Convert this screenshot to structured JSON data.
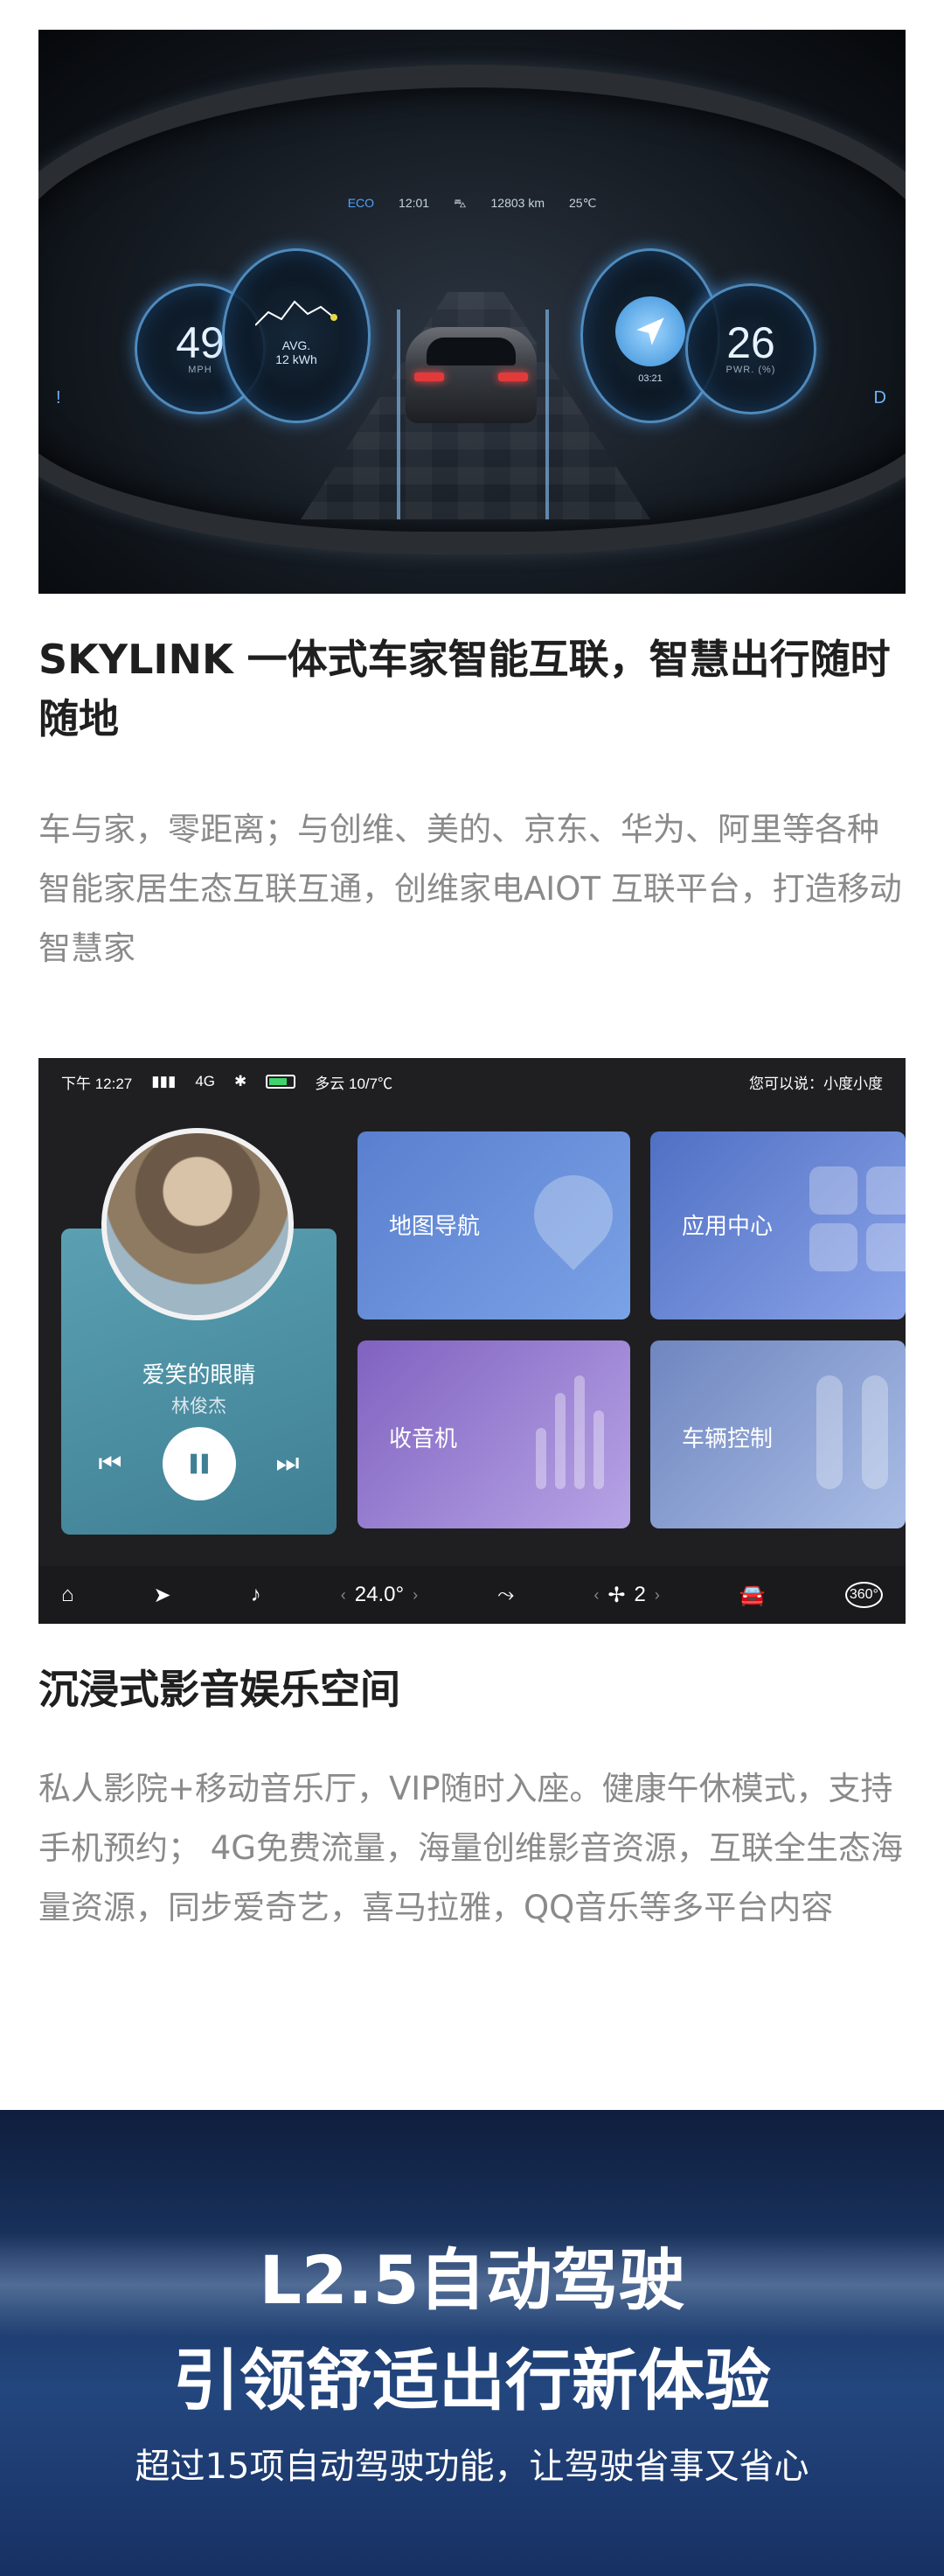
{
  "cluster": {
    "status_eco": "ECO",
    "status_time": "12:01",
    "status_odo": "12803 km",
    "status_temp": "25℃",
    "speed_value": "49",
    "speed_unit": "MPH",
    "avg_label": "AVG.",
    "avg_value": "12 kWh",
    "nav_eta": "03:21",
    "pwr_value": "26",
    "pwr_unit": "PWR. (%)",
    "edge_right": "D",
    "edge_left": "!"
  },
  "section1": {
    "heading": "SKYLINK 一体式车家智能互联，智慧出行随时随地",
    "body": "车与家，零距离；与创维、美的、京东、华为、阿里等各种智能家居生态互联互通，创维家电AIOT 互联平台，打造移动智慧家"
  },
  "screen": {
    "status": {
      "time": "下午 12:27",
      "signal": "4G",
      "weather": "多云 10/7℃",
      "voice_hint": "您可以说：小度小度"
    },
    "music": {
      "song": "爱笑的眼睛",
      "artist": "林俊杰"
    },
    "tiles": {
      "map": "地图导航",
      "apps": "应用中心",
      "radio": "收音机",
      "vehicle": "车辆控制"
    },
    "dock": {
      "temperature": "24.0°",
      "fan_level": "2",
      "view360": "360°"
    }
  },
  "section2": {
    "heading": "沉浸式影音娱乐空间",
    "body": "私人影院+移动音乐厅，VIP随时入座。健康午休模式，支持手机预约； 4G免费流量，海量创维影音资源，互联全生态海量资源，同步爱奇艺，喜马拉雅，QQ音乐等多平台内容"
  },
  "banner": {
    "title_line1": "L2.5自动驾驶",
    "title_line2": "引领舒适出行新体验",
    "subtitle": "超过15项自动驾驶功能，让驾驶省事又省心"
  }
}
